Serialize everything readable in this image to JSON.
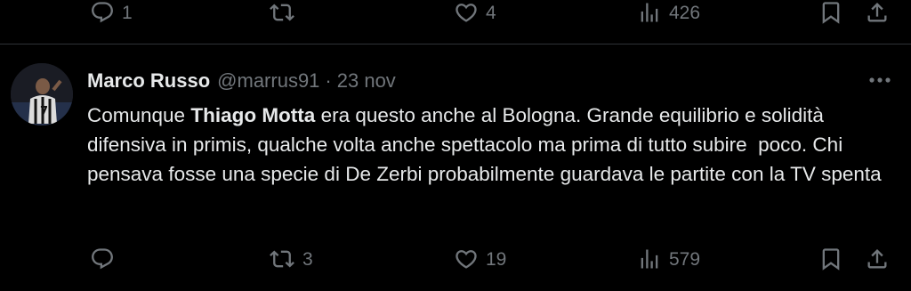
{
  "prev_tweet": {
    "actions": {
      "reply_count": "1",
      "retweet_count": "",
      "like_count": "4",
      "views_count": "426"
    }
  },
  "tweet": {
    "display_name": "Marco Russo",
    "handle": "@marrus91",
    "separator": "·",
    "date": "23 nov",
    "text_parts": [
      "Comunque ",
      "Thiago Motta",
      " era questo anche al Bologna. Grande equilibrio e solidità difensiva in primis, qualche volta anche spettacolo ma prima di tutto subire  poco. Chi pensava fosse una specie di De Zerbi probabilmente guardava le partite con la TV spenta"
    ],
    "actions": {
      "reply_count": "",
      "retweet_count": "3",
      "like_count": "19",
      "views_count": "579"
    }
  },
  "icons": {
    "reply": "reply-icon",
    "retweet": "retweet-icon",
    "like": "heart-icon",
    "views": "views-icon",
    "bookmark": "bookmark-icon",
    "share": "share-icon",
    "more": "more-icon"
  },
  "colors": {
    "background": "#000000",
    "text": "#e7e9ea",
    "secondary": "#71767b",
    "divider": "#2f3336"
  }
}
